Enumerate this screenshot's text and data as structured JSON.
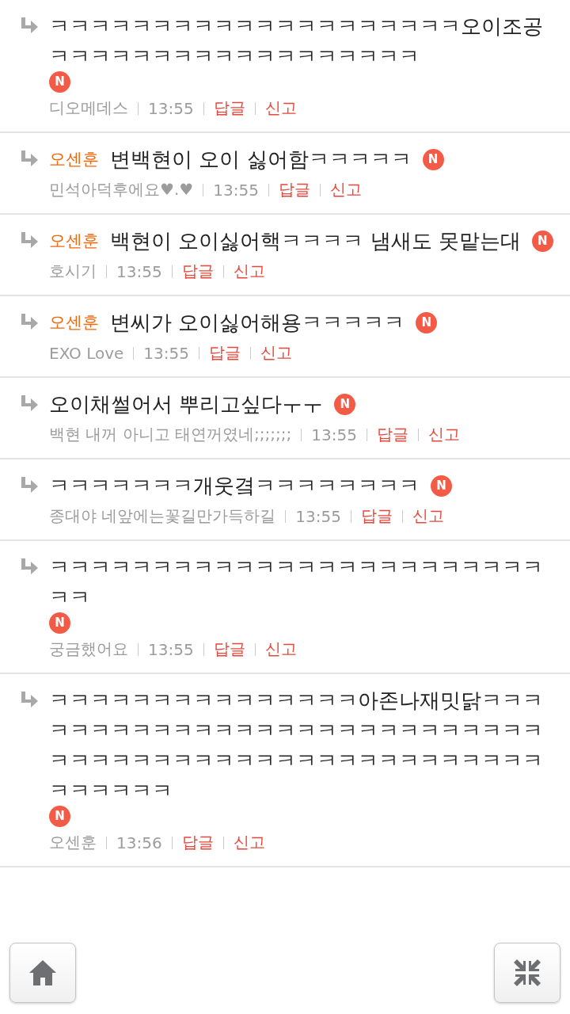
{
  "comments": [
    {
      "text": "ㅋㅋㅋㅋㅋㅋㅋㅋㅋㅋㅋㅋㅋㅋㅋㅋㅋㅋㅋㅋ오이조공ㅋㅋㅋㅋㅋㅋㅋㅋㅋㅋㅋㅋㅋㅋㅋㅋㅋㅋ",
      "badge": "N",
      "author": "디오메데스",
      "time": "13:55",
      "reply": "답글",
      "report": "신고"
    },
    {
      "mention": "오센훈",
      "text": "변백현이 오이 싫어함ㅋㅋㅋㅋㅋ",
      "badge": "N",
      "author": "민석아덕후에요♥.♥",
      "time": "13:55",
      "reply": "답글",
      "report": "신고"
    },
    {
      "mention": "오센훈",
      "text": "백현이 오이싫어핵ㅋㅋㅋㅋ 냄새도 못맡는대",
      "badge": "N",
      "author": "호시기",
      "time": "13:55",
      "reply": "답글",
      "report": "신고"
    },
    {
      "mention": "오센훈",
      "text": "변씨가 오이싫어해용ㅋㅋㅋㅋㅋ",
      "badge": "N",
      "author": "EXO Love",
      "time": "13:55",
      "reply": "답글",
      "report": "신고"
    },
    {
      "text": "오이채썰어서 뿌리고싶다ㅜㅜ",
      "badge": "N",
      "author": "백현 내꺼 아니고 태연꺼였네;;;;;;;",
      "time": "13:55",
      "reply": "답글",
      "report": "신고"
    },
    {
      "text": "ㅋㅋㅋㅋㅋㅋㅋ개웃곀ㅋㅋㅋㅋㅋㅋㅋㅋ",
      "badge": "N",
      "author": "종대야 네앞에는꽃길만가득하길",
      "time": "13:55",
      "reply": "답글",
      "report": "신고"
    },
    {
      "text": "ㅋㅋㅋㅋㅋㅋㅋㅋㅋㅋㅋㅋㅋㅋㅋㅋㅋㅋㅋㅋㅋㅋㅋㅋㅋㅋ",
      "badge": "N",
      "author": "궁금했어요",
      "time": "13:55",
      "reply": "답글",
      "report": "신고"
    },
    {
      "text": "ㅋㅋㅋㅋㅋㅋㅋㅋㅋㅋㅋㅋㅋㅋㅋ아존나재밋닭ㅋㅋㅋㅋㅋㅋㅋㅋㅋㅋㅋㅋㅋㅋㅋㅋㅋㅋㅋㅋㅋㅋㅋㅋㅋㅋㅋㅋㅋㅋㅋㅋㅋㅋㅋㅋㅋㅋㅋㅋㅋㅋㅋㅋㅋㅋㅋㅋㅋㅋㅋㅋㅋㅋㅋㅋㅋ",
      "badge": "N",
      "author": "오센훈",
      "time": "13:56",
      "reply": "답글",
      "report": "신고"
    }
  ]
}
